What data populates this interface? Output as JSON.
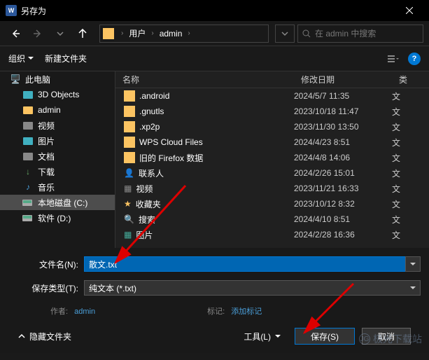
{
  "title": "另存为",
  "breadcrumb": {
    "part1": "用户",
    "part2": "admin"
  },
  "search": {
    "placeholder": "在 admin 中搜索"
  },
  "toolbar": {
    "organize": "组织",
    "newfolder": "新建文件夹"
  },
  "sidebar": {
    "thispc": "此电脑",
    "items": [
      {
        "label": "3D Objects",
        "color": "#40b0c0"
      },
      {
        "label": "admin",
        "color": "#fcc462"
      },
      {
        "label": "视频",
        "color": "#888"
      },
      {
        "label": "图片",
        "color": "#40b0c0"
      },
      {
        "label": "文档",
        "color": "#888"
      },
      {
        "label": "下载",
        "color": "#6a6"
      },
      {
        "label": "音乐",
        "color": "#4a9ed8"
      },
      {
        "label": "本地磁盘 (C:)",
        "color": "#aaa"
      },
      {
        "label": "软件 (D:)",
        "color": "#aaa"
      }
    ]
  },
  "columns": {
    "name": "名称",
    "date": "修改日期",
    "type": "类"
  },
  "files": [
    {
      "name": ".android",
      "date": "2024/5/7 11:35",
      "type": "文",
      "icon": "folder"
    },
    {
      "name": ".gnutls",
      "date": "2023/10/18 11:47",
      "type": "文",
      "icon": "folder"
    },
    {
      "name": ".xp2p",
      "date": "2023/11/30 13:50",
      "type": "文",
      "icon": "folder"
    },
    {
      "name": "WPS Cloud Files",
      "date": "2024/4/23 8:51",
      "type": "文",
      "icon": "folder"
    },
    {
      "name": "旧的 Firefox 数据",
      "date": "2024/4/8 14:06",
      "type": "文",
      "icon": "folder"
    },
    {
      "name": "联系人",
      "date": "2024/2/26 15:01",
      "type": "文",
      "icon": "contacts"
    },
    {
      "name": "视频",
      "date": "2023/11/21 16:33",
      "type": "文",
      "icon": "video"
    },
    {
      "name": "收藏夹",
      "date": "2023/10/12 8:32",
      "type": "文",
      "icon": "star"
    },
    {
      "name": "搜索",
      "date": "2024/4/10 8:51",
      "type": "文",
      "icon": "search"
    },
    {
      "name": "图片",
      "date": "2024/2/28 16:36",
      "type": "文",
      "icon": "image"
    }
  ],
  "form": {
    "filename_label": "文件名(N):",
    "filename_value": "散文.txt",
    "filetype_label": "保存类型(T):",
    "filetype_value": "纯文本 (*.txt)",
    "author_label": "作者:",
    "author_value": "admin",
    "tags_label": "标记:",
    "tags_value": "添加标记"
  },
  "footer": {
    "hidefolders": "隐藏文件夹",
    "tools": "工具(L)",
    "save": "保存(S)",
    "cancel": "取消"
  },
  "watermark": "极光下载站"
}
